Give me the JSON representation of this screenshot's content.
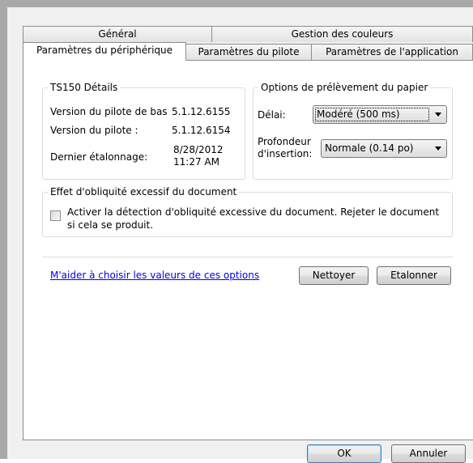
{
  "tabs": {
    "row1": [
      {
        "label": "Général"
      },
      {
        "label": "Gestion des couleurs"
      }
    ],
    "row2": [
      {
        "label": "Paramètres du périphérique",
        "active": true
      },
      {
        "label": "Paramètres du pilote"
      },
      {
        "label": "Paramètres de l'application"
      }
    ]
  },
  "details": {
    "title": "TS150 Détails",
    "base_driver_label": "Version du pilote de bas",
    "base_driver_value": "5.1.12.6155",
    "driver_label": "Version du pilote :",
    "driver_value": "5.1.12.6154",
    "calibration_label": "Dernier étalonnage:",
    "calibration_date": "8/28/2012",
    "calibration_time": "11:27 AM"
  },
  "paper": {
    "title": "Options de prélèvement du papier",
    "delay_label": "Délai:",
    "delay_value": "Modéré (500 ms)",
    "depth_label_1": "Profondeur",
    "depth_label_2": "d'insertion:",
    "depth_value": "Normale (0.14 po)"
  },
  "skew": {
    "title": "Effet d'obliquité excessif du document",
    "checkbox_line1": "Activer la détection d'obliquité excessive du document. Rejeter le document",
    "checkbox_line2": "si cela se produit.",
    "checked": false
  },
  "help_link": "M'aider à choisir les valeurs de ces options",
  "buttons": {
    "clean": "Nettoyer",
    "calibrate": "Etalonner",
    "ok": "OK",
    "cancel": "Annuler"
  },
  "colors": {
    "dialog_bg": "#f0f0f0",
    "panel_bg": "#ffffff",
    "link": "#0000ee",
    "frame": "#a9a9a9"
  }
}
